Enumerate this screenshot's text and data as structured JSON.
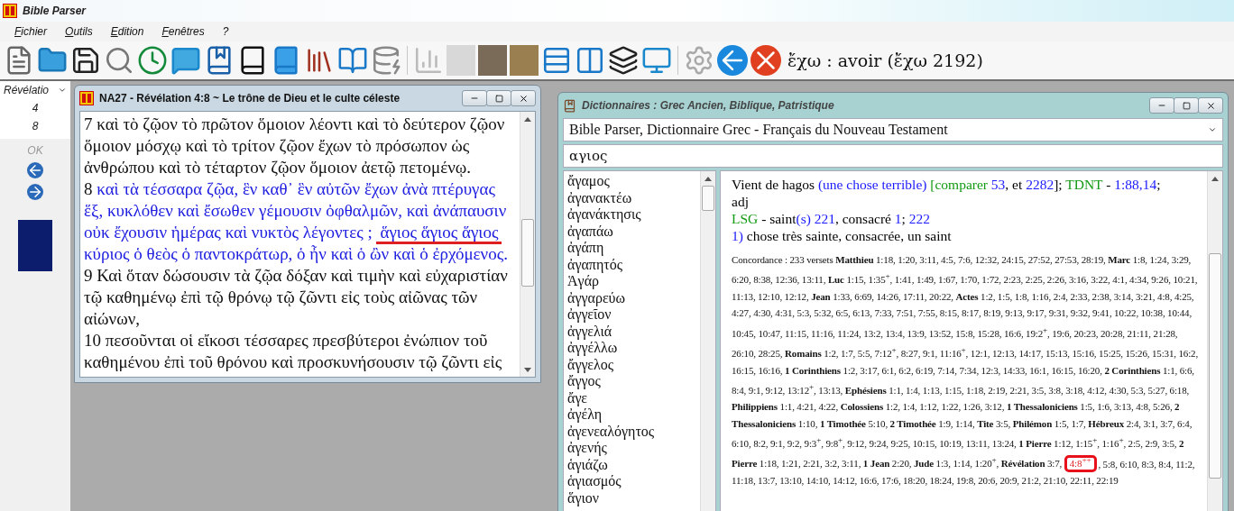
{
  "app": {
    "title": "Bible Parser"
  },
  "menu": [
    {
      "label": "Fichier"
    },
    {
      "label": "Outils"
    },
    {
      "label": "Edition"
    },
    {
      "label": "Fenêtres"
    },
    {
      "label": "?"
    }
  ],
  "toolbar": {
    "headword": "ἔχω : avoir (ἔχω 2192)"
  },
  "navigator": {
    "book": "Révélatio",
    "chapter": "4",
    "verse": "8",
    "ok": "OK",
    "ok_disabled": true
  },
  "text_window": {
    "title": "NA27 - Révélation 4:8 ~ Le trône de Dieu et le culte céleste",
    "verses": [
      {
        "number": "7",
        "text": "καὶ τὸ ζῷον τὸ πρῶτον ὅμοιον λέοντι καὶ τὸ δεύτερον ζῷον ὅμοιον μόσχῳ καὶ τὸ τρίτον ζῷον ἔχων τὸ πρόσωπον ὡς ἀνθρώπου καὶ τὸ τέταρτον ζῷον ὅμοιον ἀετῷ πετομένῳ.",
        "selected": false
      },
      {
        "number": "8",
        "text": "καὶ τὰ τέσσαρα ζῷα, ἓν καθ᾽ ἓν αὐτῶν ἔχων ἀνὰ πτέρυγας ἕξ, κυκλόθεν καὶ ἔσωθεν γέμουσιν ὀφθαλμῶν, καὶ ἀνάπαυσιν οὐκ ἔχουσιν ἡμέρας καὶ νυκτὸς λέγοντες ;",
        "marked": "ἅγιος ἅγιος ἅγιος",
        "rest": "κύριος ὁ θεὸς ὁ παντοκράτωρ, ὁ ἦν καὶ ὁ ὢν καὶ ὁ ἐρχόμενος.",
        "selected": true
      },
      {
        "number": "9",
        "text": "Καὶ ὅταν δώσουσιν τὰ ζῷα δόξαν καὶ τιμὴν καὶ εὐχαριστίαν τῷ καθημένῳ ἐπὶ τῷ θρόνῳ τῷ ζῶντι εἰς τοὺς αἰῶνας τῶν αἰώνων,",
        "selected": false
      },
      {
        "number": "10",
        "text": "πεσοῦνται οἱ εἴκοσι τέσσαρες πρεσβύτεροι ἐνώπιον τοῦ καθημένου ἐπὶ τοῦ θρόνου καὶ προσκυνήσουσιν τῷ ζῶντι εἰς",
        "selected": false
      }
    ]
  },
  "dictionary_window": {
    "title": "Dictionnaires : Grec Ancien, Biblique, Patristique",
    "dictionary": "Bible Parser, Dictionnaire Grec - Français du Nouveau Testament",
    "search": "αγιος",
    "words": [
      "ἄγαμος",
      "ἀγανακτέω",
      "ἀγανάκτησις",
      "ἀγαπάω",
      "ἀγάπη",
      "ἀγαπητός",
      "Ἁγάρ",
      "ἀγγαρεύω",
      "ἀγγεῖον",
      "ἀγγελιά",
      "ἀγγέλλω",
      "ἄγγελος",
      "ἄγγος",
      "ἄγε",
      "ἀγέλη",
      "ἀγενεαλόγητος",
      "ἀγενής",
      "ἁγιάζω",
      "ἁγιασμός",
      "ἅγιον"
    ],
    "definition": [
      [
        {
          "text": "Vient de hagos ",
          "kind": "plain"
        },
        {
          "text": "(une chose terrible)",
          "kind": "ref"
        },
        {
          "text": " [comparer",
          "kind": "term"
        },
        {
          "text": " 53",
          "kind": "ref"
        },
        {
          "text": ", et ",
          "kind": "plain"
        },
        {
          "text": "2282",
          "kind": "ref"
        },
        {
          "text": "]; ",
          "kind": "plain"
        },
        {
          "text": "TDNT",
          "kind": "term"
        },
        {
          "text": " - ",
          "kind": "plain"
        },
        {
          "text": "1:88,14",
          "kind": "ref"
        },
        {
          "text": ";",
          "kind": "plain"
        }
      ],
      [
        {
          "text": "adj",
          "kind": "plain"
        }
      ],
      [
        {
          "text": "LSG",
          "kind": "term"
        },
        {
          "text": " - saint",
          "kind": "plain"
        },
        {
          "text": "(s) 221",
          "kind": "ref"
        },
        {
          "text": ", consacré ",
          "kind": "plain"
        },
        {
          "text": "1",
          "kind": "ref"
        },
        {
          "text": "; ",
          "kind": "plain"
        },
        {
          "text": "222",
          "kind": "ref"
        }
      ],
      [
        {
          "text": "1)",
          "kind": "ref"
        },
        {
          "text": " chose très sainte, consacrée, un saint",
          "kind": "plain"
        }
      ]
    ],
    "concordance": {
      "before": "Concordance : 233 versets **Matthieu** 1:18, 1:20, 3:11, 4:5, 7:6, 12:32, 24:15, 27:52, 27:53, 28:19, **Marc** 1:8, 1:24, 3:29, 6:20, 8:38, 12:36, 13:11, **Luc** 1:15, 1:35$^{+}$, 1:41, 1:49, 1:67, 1:70, 1:72, 2:23, 2:25, 2:26, 3:16, 3:22, 4:1, 4:34, 9:26, 10:21, 11:13, 12:10, 12:12, **Jean** 1:33, 6:69, 14:26, 17:11, 20:22, **Actes** 1:2, 1:5, 1:8, 1:16, 2:4, 2:33, 2:38, 3:14, 3:21, 4:8, 4:25, 4:27, 4:30, 4:31, 5:3, 5:32, 6:5, 6:13, 7:33, 7:51, 7:55, 8:15, 8:17, 8:19, 9:13, 9:17, 9:31, 9:32, 9:41, 10:22, 10:38, 10:44, 10:45, 10:47, 11:15, 11:16, 11:24, 13:2, 13:4, 13:9, 13:52, 15:8, 15:28, 16:6, 19:2$^{+}$, 19:6, 20:23, 20:28, 21:11, 21:28, 26:10, 28:25, **Romains** 1:2, 1:7, 5:5, 7:12$^{+}$, 8:27, 9:1, 11:16$^{+}$, 12:1, 12:13, 14:17, 15:13, 15:16, 15:25, 15:26, 15:31, 16:2, 16:15, 16:16, **1 Corinthiens** 1:2, 3:17, 6:1, 6:2, 6:19, 7:14, 7:34, 12:3, 14:33, 16:1, 16:15, 16:20, **2 Corinthiens** 1:1, 6:6, 8:4, 9:1, 9:12, 13:12$^{+}$, 13:13, **Ephésiens** 1:1, 1:4, 1:13, 1:15, 1:18, 2:19, 2:21, 3:5, 3:8, 3:18, 4:12, 4:30, 5:3, 5:27, 6:18, **Philippiens** 1:1, 4:21, 4:22, **Colossiens** 1:2, 1:4, 1:12, 1:22, 1:26, 3:12, **1 Thessaloniciens** 1:5, 1:6, 3:13, 4:8, 5:26, **2 Thessaloniciens** 1:10, **1 Timothée** 5:10, **2 Timothée** 1:9, 1:14, **Tite** 3:5, **Philémon** 1:5, 1:7, **Hébreux** 2:4, 3:1, 3:7, 6:4, 6:10, 8:2, 9:1, 9:2, 9:3$^{+}$, 9:8$^{+}$, 9:12, 9:24, 9:25, 10:15, 10:19, 13:11, 13:24, **1 Pierre** 1:12, 1:15$^{+}$, 1:16$^{+}$, 2:5, 2:9, 3:5, **2 Pierre** 1:18, 1:21, 2:21, 3:2, 3:11, **1 Jean** 2:20, **Jude** 1:3, 1:14, 1:20$^{+}$, **Révélation** 3:7, ",
      "highlight": "4:8$^{++}$",
      "after": ", 5:8, 6:10, 8:3, 8:4, 11:2, 11:18, 13:7, 13:10, 14:10, 14:12, 16:6, 17:6, 18:20, 18:24, 19:8, 20:6, 20:9, 21:2, 21:10, 22:11, 22:19"
    }
  }
}
